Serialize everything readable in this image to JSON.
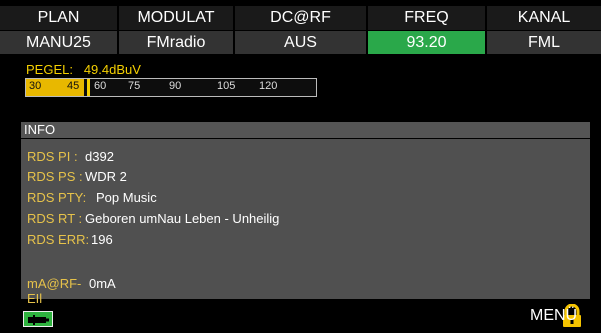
{
  "header": {
    "columns": [
      "PLAN",
      "MODULAT",
      "DC@RF",
      "FREQ",
      "KANAL"
    ],
    "values": [
      "MANU25",
      "FMradio",
      "AUS",
      "93.20",
      "FML"
    ]
  },
  "level": {
    "label": "PEGEL:",
    "value": "49.4dBuV",
    "ticks": [
      "30",
      "45",
      "60",
      "75",
      "90",
      "105",
      "120"
    ],
    "fill_percent": 20
  },
  "info": {
    "title": "INFO",
    "rows": [
      {
        "label": "RDS PI :",
        "value": "d392"
      },
      {
        "label": "RDS PS :",
        "value": "WDR 2"
      },
      {
        "label": "RDS PTY:",
        "value": "Pop Music"
      },
      {
        "label": "RDS RT :",
        "value": "Geboren umNau Leben - Unheilig"
      },
      {
        "label": "RDS ERR:",
        "value": "196"
      },
      {
        "label": "mA@RF-EIl",
        "value": "0mA"
      }
    ]
  },
  "footer": {
    "menu_label": "MENÜ",
    "battery_icon": "battery-charging-icon",
    "lock_icon": "padlock-icon",
    "colors": {
      "accent": "#2aa84a",
      "label": "#e6c24a",
      "bar": "#e8b800"
    }
  }
}
